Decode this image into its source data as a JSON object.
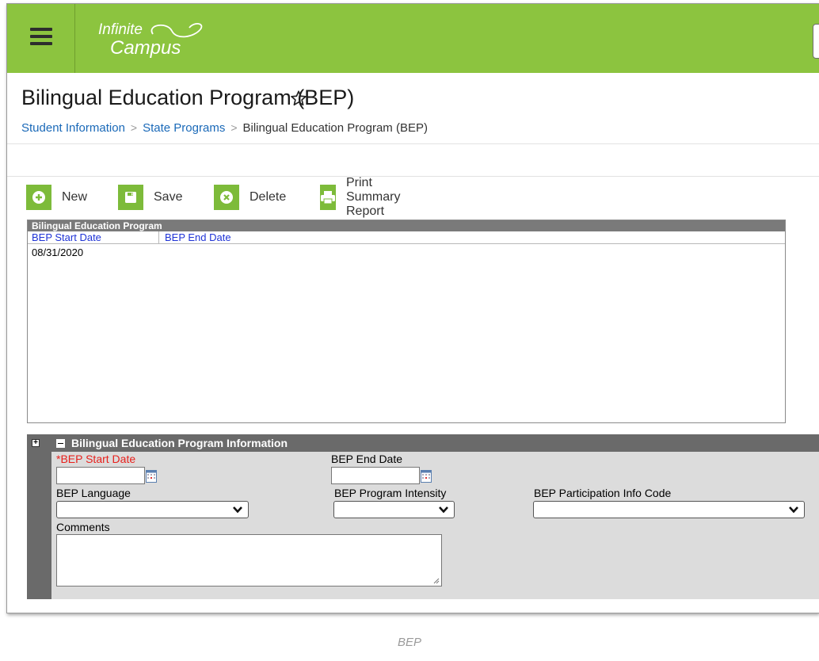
{
  "header": {
    "logo_line1": "Infinite",
    "logo_line2": "Campus",
    "brand_color": "#8cc43f"
  },
  "page": {
    "title": "Bilingual Education Program (BEP)",
    "breadcrumb": [
      "Student Information",
      "State Programs",
      "Bilingual Education Program (BEP)"
    ]
  },
  "toolbar": {
    "new_label": "New",
    "save_label": "Save",
    "delete_label": "Delete",
    "print_label": "Print Summary Report"
  },
  "grid": {
    "title": "Bilingual Education Program",
    "columns": [
      "BEP Start Date",
      "BEP End Date"
    ],
    "rows": [
      {
        "start_date": "08/31/2020",
        "end_date": ""
      }
    ]
  },
  "detail": {
    "title": "Bilingual Education Program Information",
    "start_date_label": "*BEP Start Date",
    "start_date_value": "",
    "end_date_label": "BEP End Date",
    "end_date_value": "",
    "language_label": "BEP Language",
    "language_value": "",
    "intensity_label": "BEP Program Intensity",
    "intensity_value": "",
    "participation_label": "BEP Participation Info Code",
    "participation_value": "",
    "comments_label": "Comments",
    "comments_value": ""
  },
  "caption": "BEP"
}
